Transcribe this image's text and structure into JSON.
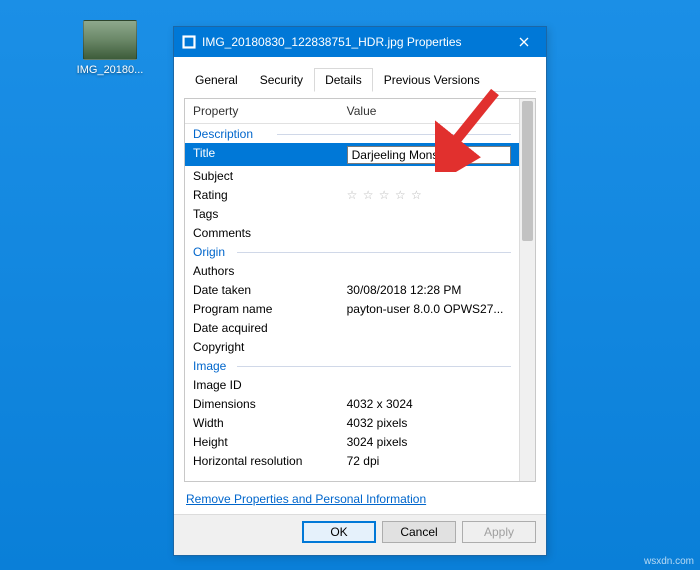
{
  "desktop": {
    "file_label": "IMG_20180..."
  },
  "window": {
    "title": "IMG_20180830_122838751_HDR.jpg Properties"
  },
  "tabs": [
    "General",
    "Security",
    "Details",
    "Previous Versions"
  ],
  "columns": {
    "property": "Property",
    "value": "Value"
  },
  "groups": {
    "description": "Description",
    "origin": "Origin",
    "image": "Image"
  },
  "details": {
    "title": {
      "label": "Title",
      "value": "Darjeeling Monsoon"
    },
    "subject": {
      "label": "Subject",
      "value": ""
    },
    "rating": {
      "label": "Rating",
      "stars": "☆ ☆ ☆ ☆ ☆"
    },
    "tags": {
      "label": "Tags",
      "value": ""
    },
    "comments": {
      "label": "Comments",
      "value": ""
    },
    "authors": {
      "label": "Authors",
      "value": ""
    },
    "date_taken": {
      "label": "Date taken",
      "value": "30/08/2018 12:28 PM"
    },
    "program_name": {
      "label": "Program name",
      "value": "payton-user 8.0.0 OPWS27..."
    },
    "date_acquired": {
      "label": "Date acquired",
      "value": ""
    },
    "copyright": {
      "label": "Copyright",
      "value": ""
    },
    "image_id": {
      "label": "Image ID",
      "value": ""
    },
    "dimensions": {
      "label": "Dimensions",
      "value": "4032 x 3024"
    },
    "width": {
      "label": "Width",
      "value": "4032 pixels"
    },
    "height": {
      "label": "Height",
      "value": "3024 pixels"
    },
    "hres": {
      "label": "Horizontal resolution",
      "value": "72 dpi"
    }
  },
  "link": "Remove Properties and Personal Information",
  "buttons": {
    "ok": "OK",
    "cancel": "Cancel",
    "apply": "Apply"
  },
  "watermark": "wsxdn.com"
}
